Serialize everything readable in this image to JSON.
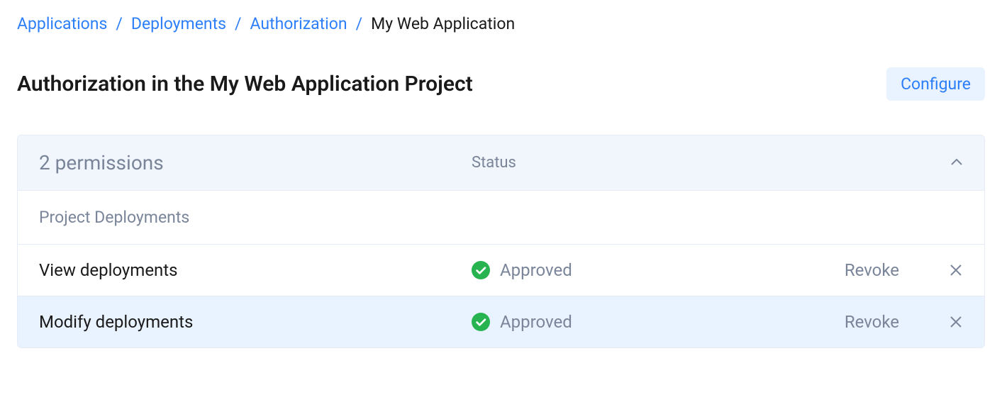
{
  "breadcrumb": {
    "items": [
      {
        "label": "Applications"
      },
      {
        "label": "Deployments"
      },
      {
        "label": "Authorization"
      }
    ],
    "current": "My Web Application",
    "separator": "/"
  },
  "header": {
    "title": "Authorization in the My Web Application Project",
    "configure_label": "Configure"
  },
  "table": {
    "permissions_summary": "2 permissions",
    "status_header": "Status",
    "group_label": "Project Deployments",
    "rows": [
      {
        "name": "View deployments",
        "status": "Approved",
        "action": "Revoke"
      },
      {
        "name": "Modify deployments",
        "status": "Approved",
        "action": "Revoke"
      }
    ]
  }
}
